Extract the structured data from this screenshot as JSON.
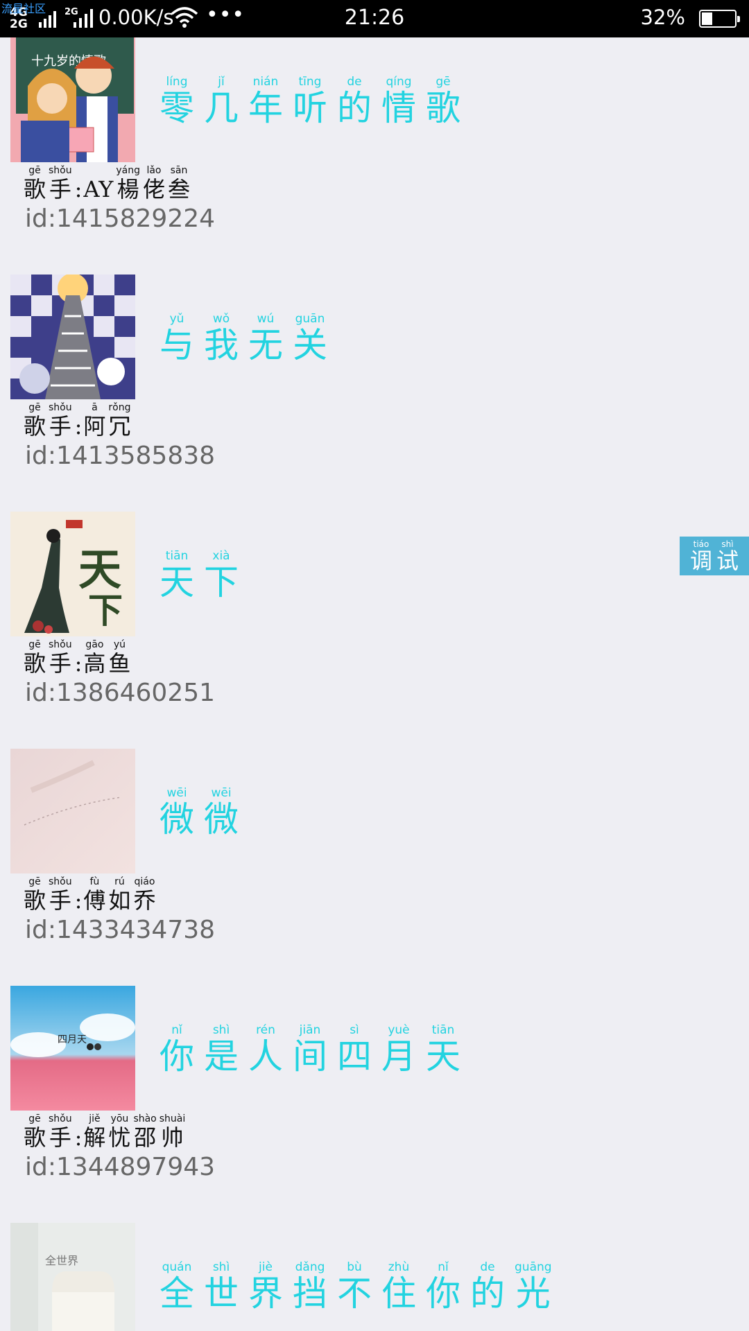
{
  "status_bar": {
    "app_label": "流星社区",
    "network_label": "4G 2G",
    "net_2g_label": "2G",
    "speed": "0.00K/s",
    "more_dots": "•••",
    "time": "21:26",
    "battery": "32%",
    "battery_level": 0.32
  },
  "debug_button": {
    "chars": [
      {
        "py": "tiáo",
        "ch": "调"
      },
      {
        "py": "shì",
        "ch": "试"
      }
    ]
  },
  "songs": [
    {
      "title": [
        {
          "py": "líng",
          "ch": "零"
        },
        {
          "py": "jǐ",
          "ch": "几"
        },
        {
          "py": "nián",
          "ch": "年"
        },
        {
          "py": "tīng",
          "ch": "听"
        },
        {
          "py": "de",
          "ch": "的"
        },
        {
          "py": "qíng",
          "ch": "情"
        },
        {
          "py": "gē",
          "ch": "歌"
        }
      ],
      "artist_label": [
        {
          "py": "gē",
          "ch": "歌"
        },
        {
          "py": "shǒu",
          "ch": "手"
        }
      ],
      "artist": [
        {
          "py": "",
          "ch": "AY"
        },
        {
          "py": "yáng",
          "ch": "楊"
        },
        {
          "py": "lǎo",
          "ch": "佬"
        },
        {
          "py": "sān",
          "ch": "叁"
        }
      ],
      "id": "id:1415829224"
    },
    {
      "title": [
        {
          "py": "yǔ",
          "ch": "与"
        },
        {
          "py": "wǒ",
          "ch": "我"
        },
        {
          "py": "wú",
          "ch": "无"
        },
        {
          "py": "guān",
          "ch": "关"
        }
      ],
      "artist_label": [
        {
          "py": "gē",
          "ch": "歌"
        },
        {
          "py": "shǒu",
          "ch": "手"
        }
      ],
      "artist": [
        {
          "py": "ā",
          "ch": "阿"
        },
        {
          "py": "rǒng",
          "ch": "冗"
        }
      ],
      "id": "id:1413585838"
    },
    {
      "title": [
        {
          "py": "tiān",
          "ch": "天"
        },
        {
          "py": "xià",
          "ch": "下"
        }
      ],
      "artist_label": [
        {
          "py": "gē",
          "ch": "歌"
        },
        {
          "py": "shǒu",
          "ch": "手"
        }
      ],
      "artist": [
        {
          "py": "gāo",
          "ch": "高"
        },
        {
          "py": "yú",
          "ch": "鱼"
        }
      ],
      "id": "id:1386460251"
    },
    {
      "title": [
        {
          "py": "wēi",
          "ch": "微"
        },
        {
          "py": "wēi",
          "ch": "微"
        }
      ],
      "artist_label": [
        {
          "py": "gē",
          "ch": "歌"
        },
        {
          "py": "shǒu",
          "ch": "手"
        }
      ],
      "artist": [
        {
          "py": "fù",
          "ch": "傅"
        },
        {
          "py": "rú",
          "ch": "如"
        },
        {
          "py": "qiáo",
          "ch": "乔"
        }
      ],
      "id": "id:1433434738"
    },
    {
      "title": [
        {
          "py": "nǐ",
          "ch": "你"
        },
        {
          "py": "shì",
          "ch": "是"
        },
        {
          "py": "rén",
          "ch": "人"
        },
        {
          "py": "jiān",
          "ch": "间"
        },
        {
          "py": "sì",
          "ch": "四"
        },
        {
          "py": "yuè",
          "ch": "月"
        },
        {
          "py": "tiān",
          "ch": "天"
        }
      ],
      "artist_label": [
        {
          "py": "gē",
          "ch": "歌"
        },
        {
          "py": "shǒu",
          "ch": "手"
        }
      ],
      "artist": [
        {
          "py": "jiě",
          "ch": "解"
        },
        {
          "py": "yōu",
          "ch": "忧"
        },
        {
          "py": "shào",
          "ch": "邵"
        },
        {
          "py": "shuài",
          "ch": "帅"
        }
      ],
      "id": "id:1344897943"
    },
    {
      "title": [
        {
          "py": "quán",
          "ch": "全"
        },
        {
          "py": "shì",
          "ch": "世"
        },
        {
          "py": "jiè",
          "ch": "界"
        },
        {
          "py": "dǎng",
          "ch": "挡"
        },
        {
          "py": "bù",
          "ch": "不"
        },
        {
          "py": "zhù",
          "ch": "住"
        },
        {
          "py": "nǐ",
          "ch": "你"
        },
        {
          "py": "de",
          "ch": "的"
        },
        {
          "py": "guāng",
          "ch": "光"
        }
      ],
      "artist_label": [],
      "artist": [],
      "id": ""
    }
  ]
}
